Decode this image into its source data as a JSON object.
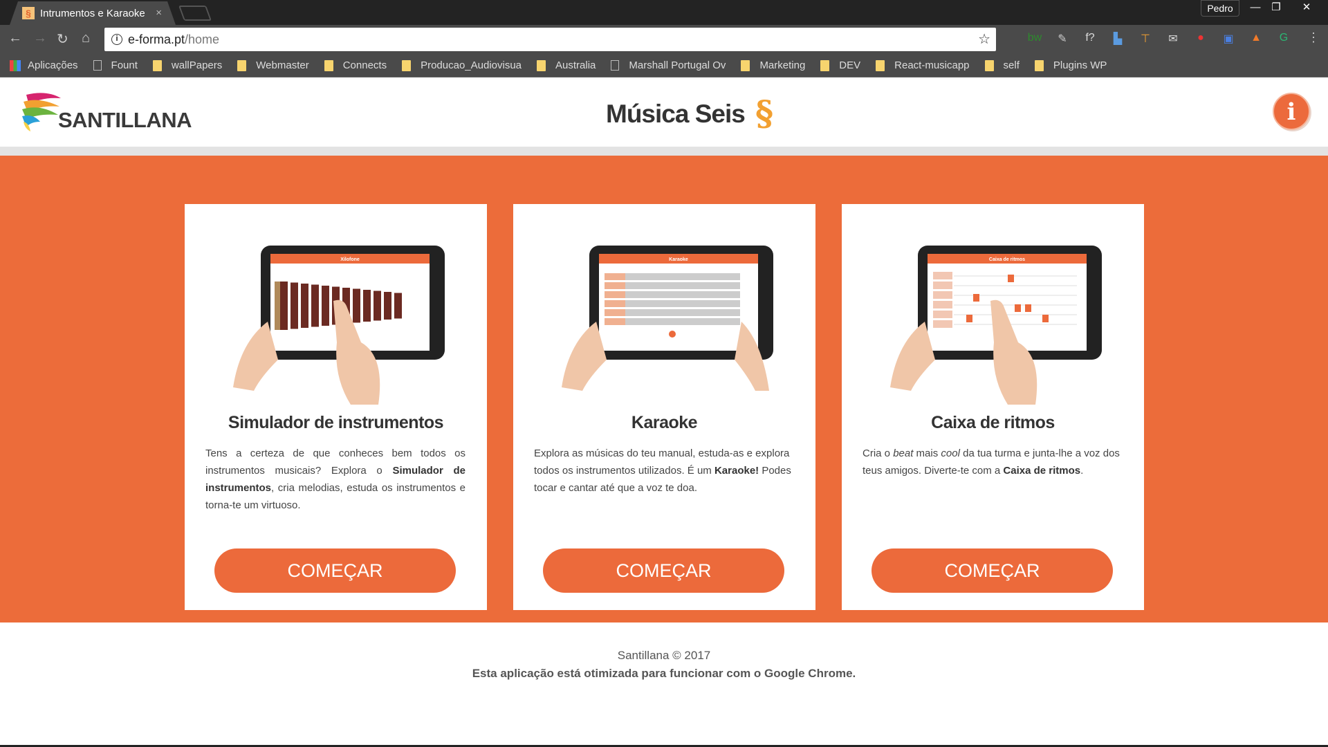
{
  "browser": {
    "tab_title": "Intrumentos e Karaoke",
    "tab_close": "×",
    "user": "Pedro",
    "window_buttons": [
      "—",
      "❐",
      "✕"
    ],
    "url_host": "e-forma.pt",
    "url_path": "/home",
    "nav_icons": [
      "back-icon",
      "forward-icon",
      "reload-icon",
      "home-icon"
    ],
    "extensions": [
      {
        "label": "bw",
        "color": "#2d8a2d"
      },
      {
        "label": "✎",
        "color": "#ccc"
      },
      {
        "label": "f?",
        "color": "#ddd"
      },
      {
        "label": "▙",
        "color": "#5b9be0"
      },
      {
        "label": "⊤",
        "color": "#f2a031"
      },
      {
        "label": "✉",
        "color": "#ddd"
      },
      {
        "label": "●",
        "color": "#e33"
      },
      {
        "label": "▣",
        "color": "#4a7fe0"
      },
      {
        "label": "▲",
        "color": "#f07a2a"
      },
      {
        "label": "G",
        "color": "#2bb673"
      }
    ],
    "bookmarks": [
      {
        "label": "Aplicações",
        "type": "apps"
      },
      {
        "label": "Fount",
        "type": "page"
      },
      {
        "label": "wallPapers",
        "type": "folder"
      },
      {
        "label": "Webmaster",
        "type": "folder"
      },
      {
        "label": "Connects",
        "type": "folder"
      },
      {
        "label": "Producao_Audiovisua",
        "type": "folder"
      },
      {
        "label": "Australia",
        "type": "folder"
      },
      {
        "label": "Marshall Portugal Ov",
        "type": "page"
      },
      {
        "label": "Marketing",
        "type": "folder"
      },
      {
        "label": "DEV",
        "type": "folder"
      },
      {
        "label": "React-musicapp",
        "type": "folder"
      },
      {
        "label": "self",
        "type": "folder"
      },
      {
        "label": "Plugins WP",
        "type": "folder"
      }
    ]
  },
  "header": {
    "logo": "SANTILLANA",
    "title": "Música Seis",
    "info": "i"
  },
  "colors": {
    "accent": "#ec6c3a",
    "mark": "#f2a031"
  },
  "cards": [
    {
      "title": "Simulador de instrumentos",
      "text_html": "Tens a certeza de que conheces bem todos os instrumentos musicais? Explora o <b>Simulador de instrumentos</b>, cria melodias, estuda os instrumentos e torna-te um virtuoso.",
      "button": "COMEÇAR",
      "screen_title": "Xilofone"
    },
    {
      "title": "Karaoke",
      "text_html": "Explora as músicas do teu manual, estuda-as e explora todos os instrumentos utilizados. É um <b>Karaoke!</b> Podes tocar e cantar até que a voz te doa.",
      "button": "COMEÇAR",
      "screen_title": "Karaoke"
    },
    {
      "title": "Caixa de ritmos",
      "text_html": "Cria o <i>beat</i> mais <i>cool</i> da tua turma e junta-lhe a voz dos teus amigos. Diverte-te com a <b>Caixa de ritmos</b>.",
      "button": "COMEÇAR",
      "screen_title": "Caixa de ritmos"
    }
  ],
  "footer": {
    "copyright": "Santillana © 2017",
    "notice": "Esta aplicação está otimizada para funcionar com o Google Chrome."
  }
}
